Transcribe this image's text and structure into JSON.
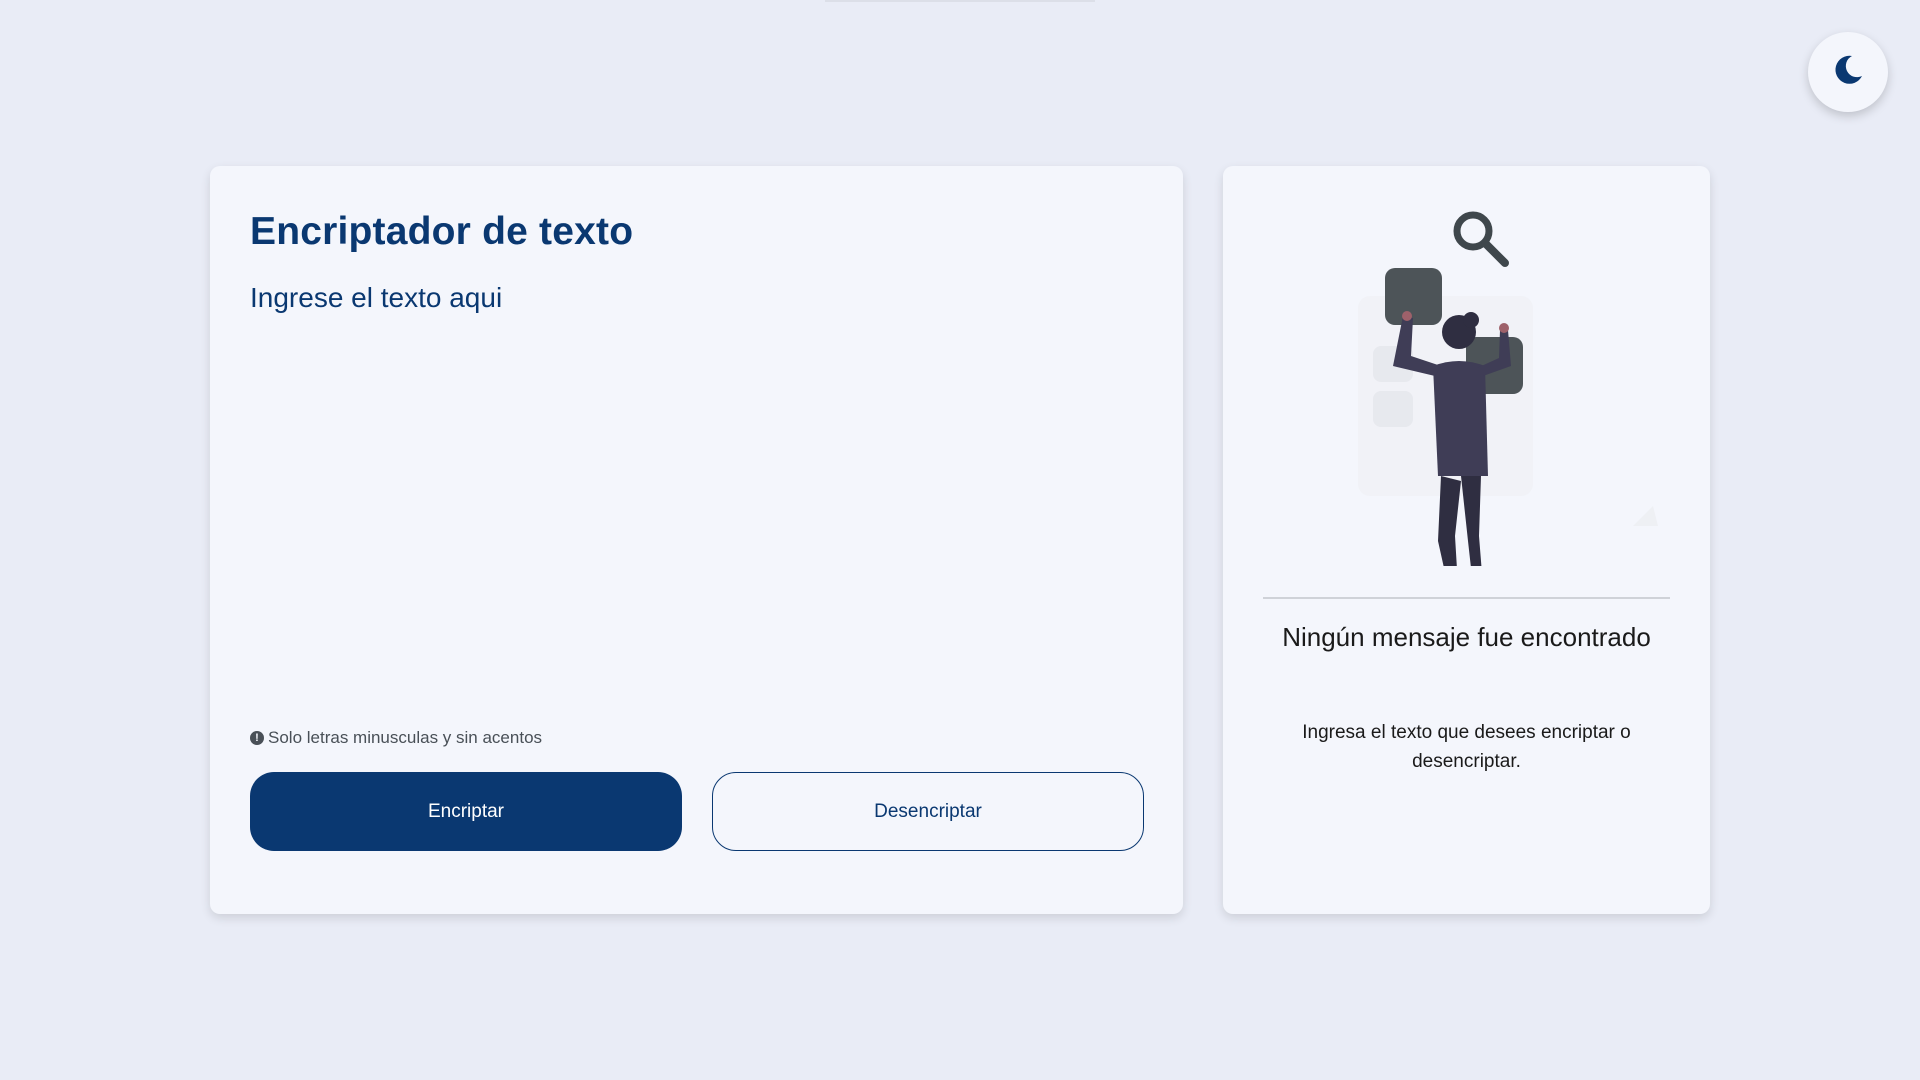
{
  "theme_toggle": {
    "icon": "moon-icon"
  },
  "encrypter": {
    "title": "Encriptador de texto",
    "input_placeholder": "Ingrese el texto aqui",
    "input_value": "",
    "hint": "Solo letras minusculas y sin acentos",
    "hint_icon": "info-icon",
    "encrypt_label": "Encriptar",
    "decrypt_label": "Desencriptar"
  },
  "output": {
    "illustration": "person-searching-illustration",
    "empty_title": "Ningún mensaje fue encontrado",
    "empty_description": "Ingresa el texto que desees encriptar o desencriptar."
  },
  "colors": {
    "background": "#e9ecf6",
    "card": "#f4f6fc",
    "primary": "#0a3871"
  }
}
